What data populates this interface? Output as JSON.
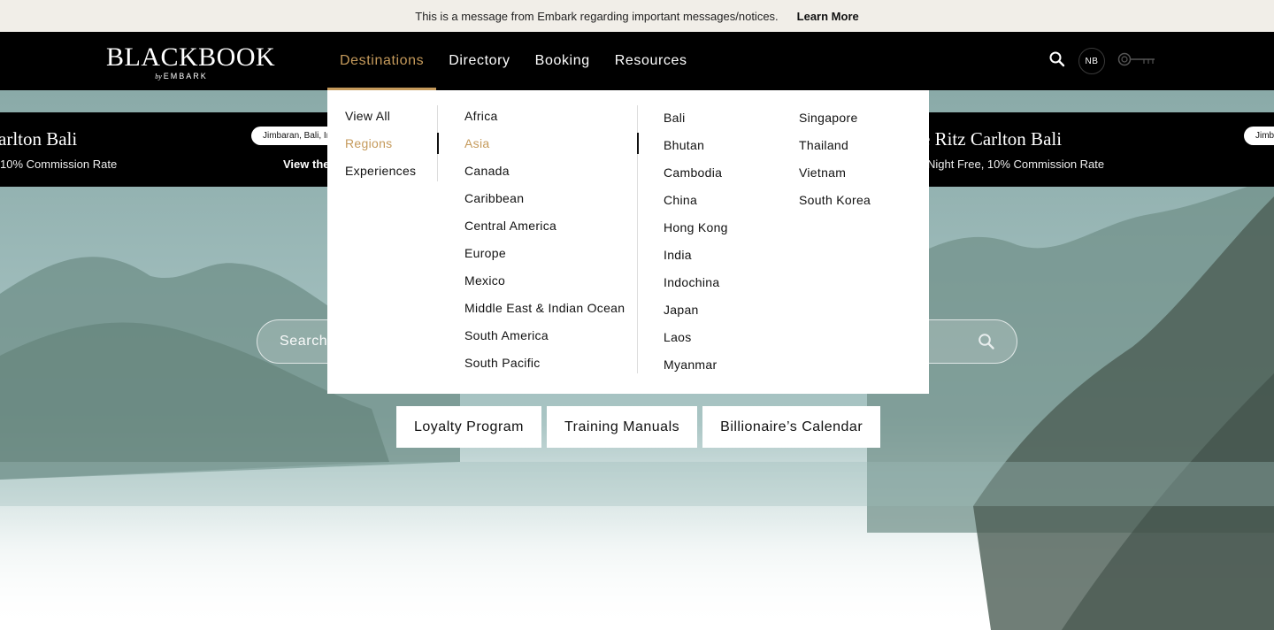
{
  "announcement": {
    "message": "This is a message from Embark regarding important messages/notices.",
    "link": "Learn More"
  },
  "header": {
    "logo_word": "BLACKBOOK",
    "logo_by": "by",
    "logo_brand": "EMBARK",
    "nav": [
      "Destinations",
      "Directory",
      "Booking",
      "Resources"
    ],
    "active_nav": "Destinations",
    "user_initials": "NB",
    "icons": [
      "search-icon",
      "key-icon"
    ]
  },
  "promo": {
    "left_title": "arlton Bali",
    "left_subtitle": "10% Commission Rate",
    "left_pill": "Jimbaran, Bali, Ir",
    "left_link": "View the",
    "right_title": "e Ritz Carlton Bali",
    "right_subtitle": "Night Free, 10% Commission Rate",
    "right_pill": "Jimb"
  },
  "search": {
    "placeholder": "Search"
  },
  "quick_links": [
    "Loyalty Program",
    "Training Manuals",
    "Billionaire’s Calendar"
  ],
  "mega_menu": {
    "types": [
      "View All",
      "Regions",
      "Experiences"
    ],
    "selected_type": "Regions",
    "regions": [
      "Africa",
      "Asia",
      "Canada",
      "Caribbean",
      "Central America",
      "Europe",
      "Mexico",
      "Middle East & Indian Ocean",
      "South America",
      "South Pacific"
    ],
    "selected_region": "Asia",
    "countries_a": [
      "Bali",
      "Bhutan",
      "Cambodia",
      "China",
      "Hong Kong",
      "India",
      "Indochina",
      "Japan",
      "Laos",
      "Myanmar"
    ],
    "countries_b": [
      "Singapore",
      "Thailand",
      "Vietnam",
      "South Korea"
    ]
  },
  "colors": {
    "accent": "#c59a5b",
    "header_bg": "#000000",
    "announce_bg": "#f1eee8"
  }
}
